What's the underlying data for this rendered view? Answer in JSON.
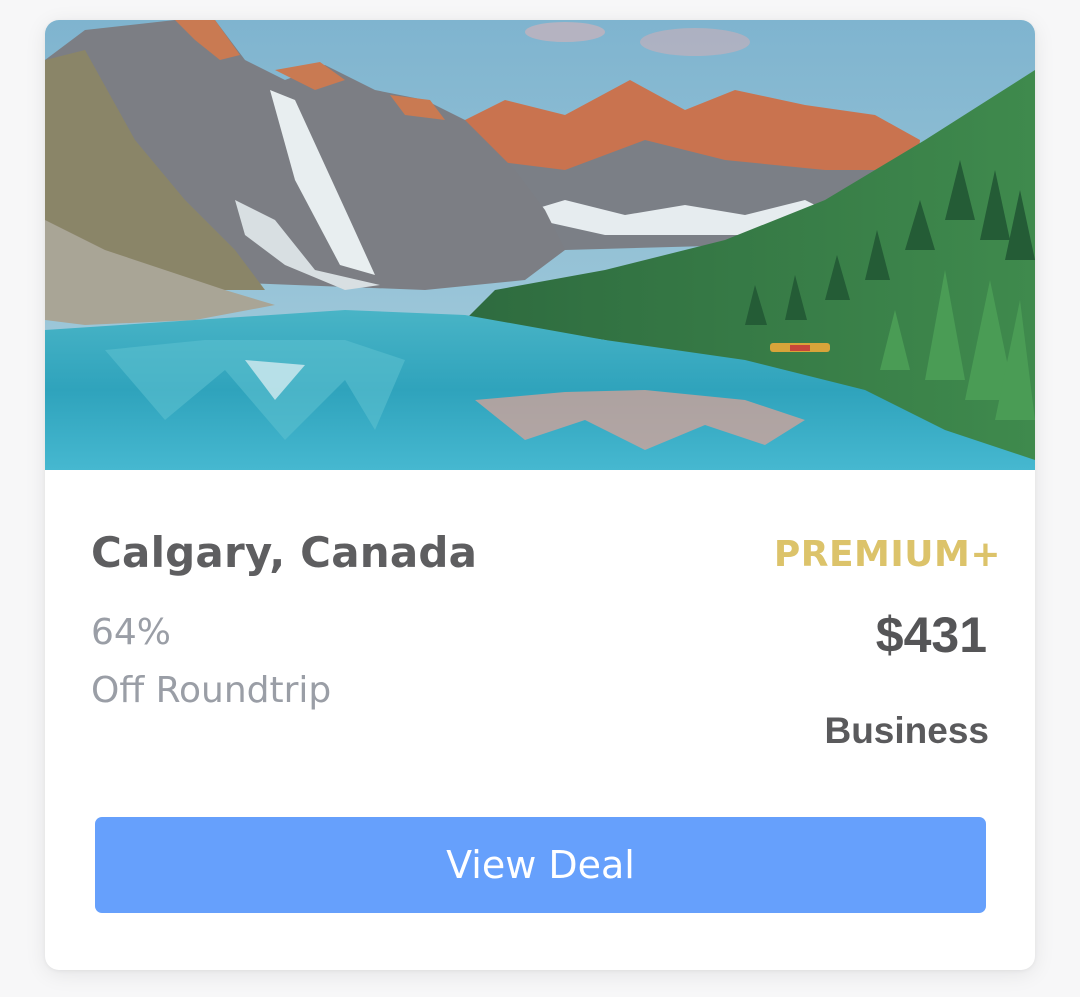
{
  "deal": {
    "destination": "Calgary, Canada",
    "discount_percent": "64%",
    "discount_label": "Off Roundtrip",
    "tier": "PREMIUM+",
    "price": "$431",
    "cabin_class": "Business",
    "cta_label": "View Deal"
  },
  "colors": {
    "tier": "#dcc36a",
    "button": "#66a0fc",
    "title": "#5e5e60",
    "muted": "#9a9ea6"
  },
  "image": {
    "subject": "mountain-lake-landscape"
  }
}
